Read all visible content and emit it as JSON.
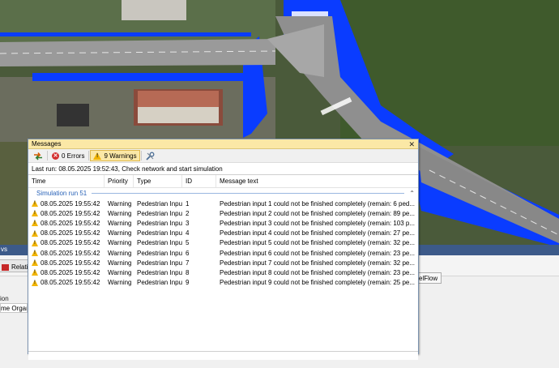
{
  "background": {
    "window_title": "vs",
    "tab_label": "Relati",
    "right_button": "elFlow",
    "label_row1": "ion",
    "label_row2": "me  Organi"
  },
  "messages": {
    "title": "Messages",
    "toolbar": {
      "errors_count": "0 Errors",
      "warnings_count": "9 Warnings"
    },
    "status_text": "Last run: 08.05.2025 19:52:43, Check network and start simulation",
    "columns": [
      "Time",
      "Priority",
      "Type",
      "ID",
      "Message text"
    ],
    "group_label": "Simulation run 51",
    "rows": [
      {
        "time": "08.05.2025 19:55:42",
        "priority": "Warning",
        "type": "Pedestrian Input",
        "id": "1",
        "text": "Pedestrian input 1 could not be finished completely  (remain: 6 ped..."
      },
      {
        "time": "08.05.2025 19:55:42",
        "priority": "Warning",
        "type": "Pedestrian Input",
        "id": "2",
        "text": "Pedestrian input 2 could not be finished completely  (remain: 89 pe..."
      },
      {
        "time": "08.05.2025 19:55:42",
        "priority": "Warning",
        "type": "Pedestrian Input",
        "id": "3",
        "text": "Pedestrian input 3 could not be finished completely  (remain: 103 p..."
      },
      {
        "time": "08.05.2025 19:55:42",
        "priority": "Warning",
        "type": "Pedestrian Input",
        "id": "4",
        "text": "Pedestrian input 4 could not be finished completely  (remain: 27 pe..."
      },
      {
        "time": "08.05.2025 19:55:42",
        "priority": "Warning",
        "type": "Pedestrian Input",
        "id": "5",
        "text": "Pedestrian input 5 could not be finished completely  (remain: 32 pe..."
      },
      {
        "time": "08.05.2025 19:55:42",
        "priority": "Warning",
        "type": "Pedestrian Input",
        "id": "6",
        "text": "Pedestrian input 6 could not be finished completely  (remain: 23 pe..."
      },
      {
        "time": "08.05.2025 19:55:42",
        "priority": "Warning",
        "type": "Pedestrian Input",
        "id": "7",
        "text": "Pedestrian input 7 could not be finished completely  (remain: 32 pe..."
      },
      {
        "time": "08.05.2025 19:55:42",
        "priority": "Warning",
        "type": "Pedestrian Input",
        "id": "8",
        "text": "Pedestrian input 8 could not be finished completely  (remain: 23 pe..."
      },
      {
        "time": "08.05.2025 19:55:42",
        "priority": "Warning",
        "type": "Pedestrian Input",
        "id": "9",
        "text": "Pedestrian input 9 could not be finished completely  (remain: 25 pe..."
      }
    ]
  },
  "colors": {
    "title_bar": "#fbe8a6",
    "warning": "#f2b500",
    "error": "#d32f2f",
    "group_text": "#2a63b8",
    "pedestrian_area": "#0a3cff"
  }
}
